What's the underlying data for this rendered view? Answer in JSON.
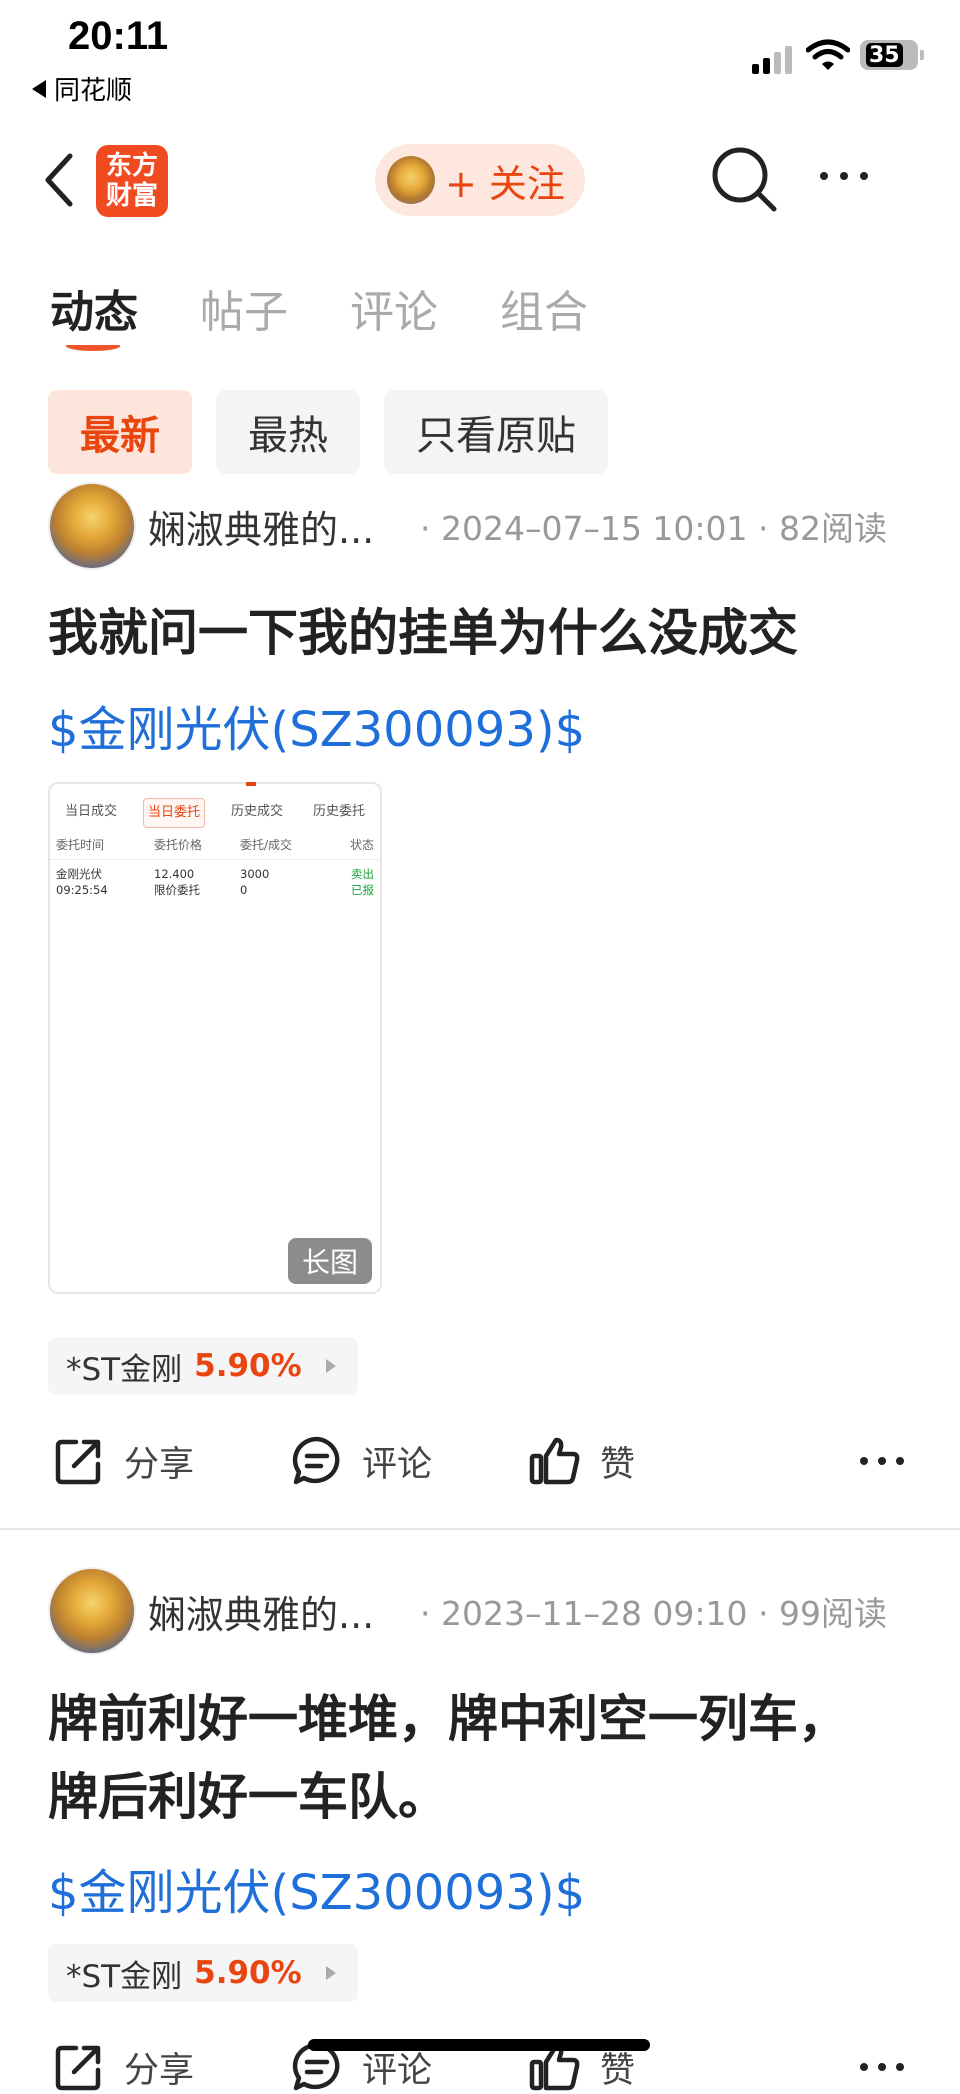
{
  "status_bar": {
    "time": "20:11",
    "back_app": "同花顺",
    "battery": "35"
  },
  "header": {
    "logo_line1": "东方",
    "logo_line2": "财富",
    "follow_label": "+ 关注"
  },
  "tabs": [
    {
      "label": "动态",
      "active": true
    },
    {
      "label": "帖子",
      "active": false
    },
    {
      "label": "评论",
      "active": false
    },
    {
      "label": "组合",
      "active": false
    }
  ],
  "filters": [
    {
      "label": "最新",
      "active": true
    },
    {
      "label": "最热",
      "active": false
    },
    {
      "label": "只看原贴",
      "active": false
    }
  ],
  "posts": [
    {
      "author": "娴淑典雅的...",
      "meta": "· 2024–07–15 10:01 · 82阅读",
      "title": "我就问一下我的挂单为什么没成交",
      "stock_link": "$金刚光伏(SZ300093)$",
      "image": {
        "tabs": [
          "当日成交",
          "当日委托",
          "历史成交",
          "历史委托"
        ],
        "headers": [
          "委托时间",
          "委托价格",
          "委托/成交",
          "状态"
        ],
        "row1": [
          "金刚光伏",
          "12.400",
          "3000",
          "卖出"
        ],
        "row2": [
          "09:25:54",
          "限价委托",
          "0",
          "已报"
        ],
        "badge": "长图"
      },
      "stock_chip": {
        "name": "*ST金刚",
        "change": "5.90%"
      },
      "actions": {
        "share": "分享",
        "comment": "评论",
        "like": "赞"
      }
    },
    {
      "author": "娴淑典雅的...",
      "meta": "· 2023–11–28 09:10 · 99阅读",
      "title_line1": "牌前利好一堆堆，牌中利空一列车，",
      "title_line2": "牌后利好一车队。",
      "stock_link": "$金刚光伏(SZ300093)$",
      "stock_chip": {
        "name": "*ST金刚",
        "change": "5.90%"
      },
      "actions": {
        "share": "分享",
        "comment": "评论",
        "like": "赞"
      }
    }
  ],
  "colors": {
    "accent": "#e8450f",
    "link": "#1e6fd9",
    "green": "#1aa33a"
  }
}
